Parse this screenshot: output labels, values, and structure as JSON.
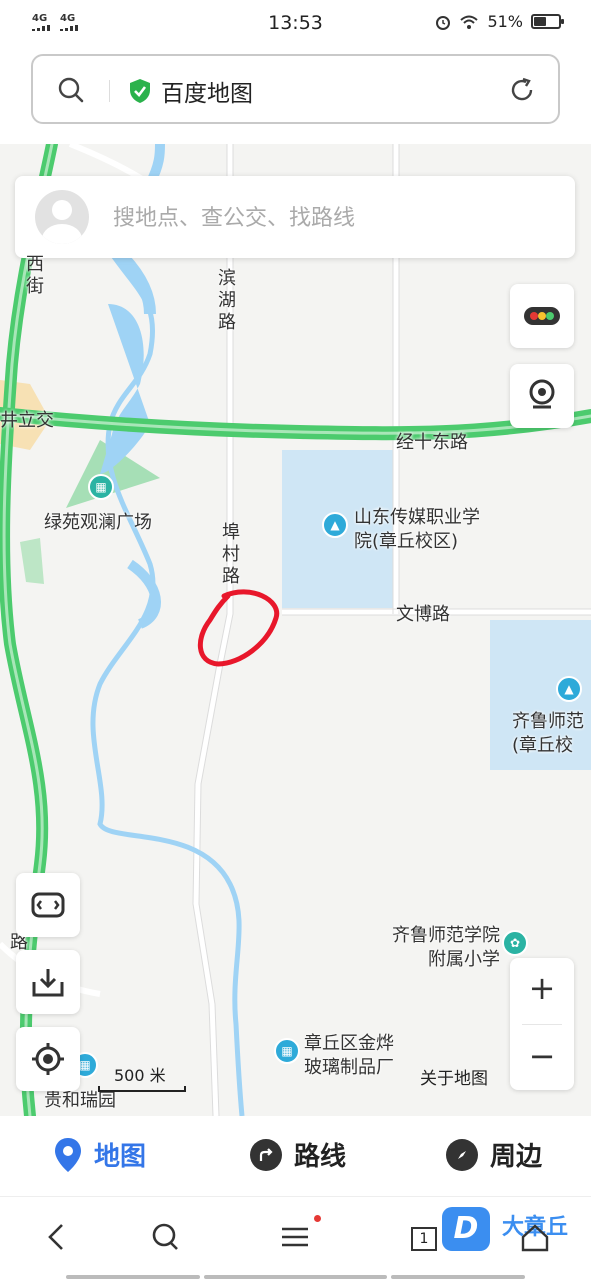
{
  "status_bar": {
    "signal_1": "4G",
    "signal_2": "4G",
    "time": "13:53",
    "battery_percent": 51,
    "battery_text": "51%"
  },
  "url_bar": {
    "site_title": "百度地图",
    "secure_icon": "shield-check-icon"
  },
  "search": {
    "placeholder": "搜地点、查公交、找路线"
  },
  "map_labels": {
    "road_west": "西街",
    "road_binhu": "滨湖路",
    "interchange": "井立交",
    "road_jingshi": "经十东路",
    "park": "绿苑观澜广场",
    "road_fucun": "埠村路",
    "school_media": "山东传媒职业学院(章丘校区)",
    "road_wenbo": "文博路",
    "school_qilu": "齐鲁师范(章丘校",
    "school_attached": "齐鲁师范学院附属小学",
    "factory": "章丘区金烨玻璃制品厂",
    "road_sw": "路",
    "estate": "贵和瑞园"
  },
  "scale": {
    "label": "500 米"
  },
  "about_link": "关于地图",
  "zoom": {
    "in": "+",
    "out": "−"
  },
  "bottom_tabs": [
    {
      "label": "地图",
      "icon": "map-pin-icon",
      "active": true
    },
    {
      "label": "路线",
      "icon": "route-icon",
      "active": false
    },
    {
      "label": "周边",
      "icon": "compass-icon",
      "active": false
    }
  ],
  "browser_nav": {
    "tab_count": "1",
    "watermark_logo": "D",
    "watermark_text": "大章丘"
  },
  "colors": {
    "accent": "#3476e8",
    "highway": "#4ccb6e",
    "river": "#9fd3f5",
    "campus": "#cfe6f5",
    "annotation": "#e8172b"
  }
}
